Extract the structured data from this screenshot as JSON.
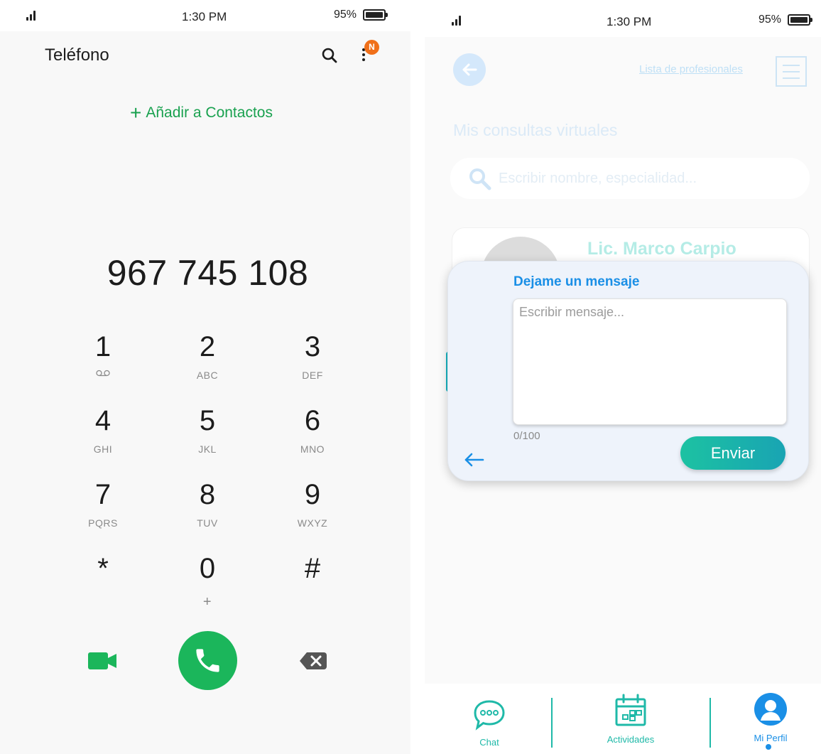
{
  "left_phone": {
    "status": {
      "time": "1:30 PM",
      "battery": "95%"
    },
    "title": "Teléfono",
    "notification_badge": "N",
    "add_contact": "Añadir a Contactos",
    "number": "967 745 108",
    "keys": [
      {
        "digit": "1",
        "letters": ""
      },
      {
        "digit": "2",
        "letters": "ABC"
      },
      {
        "digit": "3",
        "letters": "DEF"
      },
      {
        "digit": "4",
        "letters": "GHI"
      },
      {
        "digit": "5",
        "letters": "JKL"
      },
      {
        "digit": "6",
        "letters": "MNO"
      },
      {
        "digit": "7",
        "letters": "PQRS"
      },
      {
        "digit": "8",
        "letters": "TUV"
      },
      {
        "digit": "9",
        "letters": "WXYZ"
      },
      {
        "digit": "*",
        "letters": ""
      },
      {
        "digit": "0",
        "letters": "+"
      },
      {
        "digit": "#",
        "letters": ""
      }
    ],
    "colors": {
      "accent": "#1bb65b",
      "badge": "#f0701a"
    }
  },
  "right_phone": {
    "status": {
      "time": "1:30 PM",
      "battery": "95%"
    },
    "header": {
      "list_link": "Lista de profesionales"
    },
    "title": "Mis consultas virtuales",
    "search": {
      "placeholder": "Escribir nombre, especialidad..."
    },
    "card": {
      "name": "Lic. Marco Carpio"
    },
    "modal": {
      "heading": "Dejame un mensaje",
      "placeholder": "Escribir mensaje...",
      "counter": "0/100",
      "send_label": "Enviar"
    },
    "bottom_nav": [
      {
        "label": "Chat",
        "color": "#1fb9a8"
      },
      {
        "label": "Actividades",
        "color": "#1fb9a8"
      },
      {
        "label": "Mi Perfil",
        "color": "#1a8fe6"
      }
    ],
    "colors": {
      "primary": "#1a8fe6",
      "teal": "#1cc2a2"
    }
  }
}
